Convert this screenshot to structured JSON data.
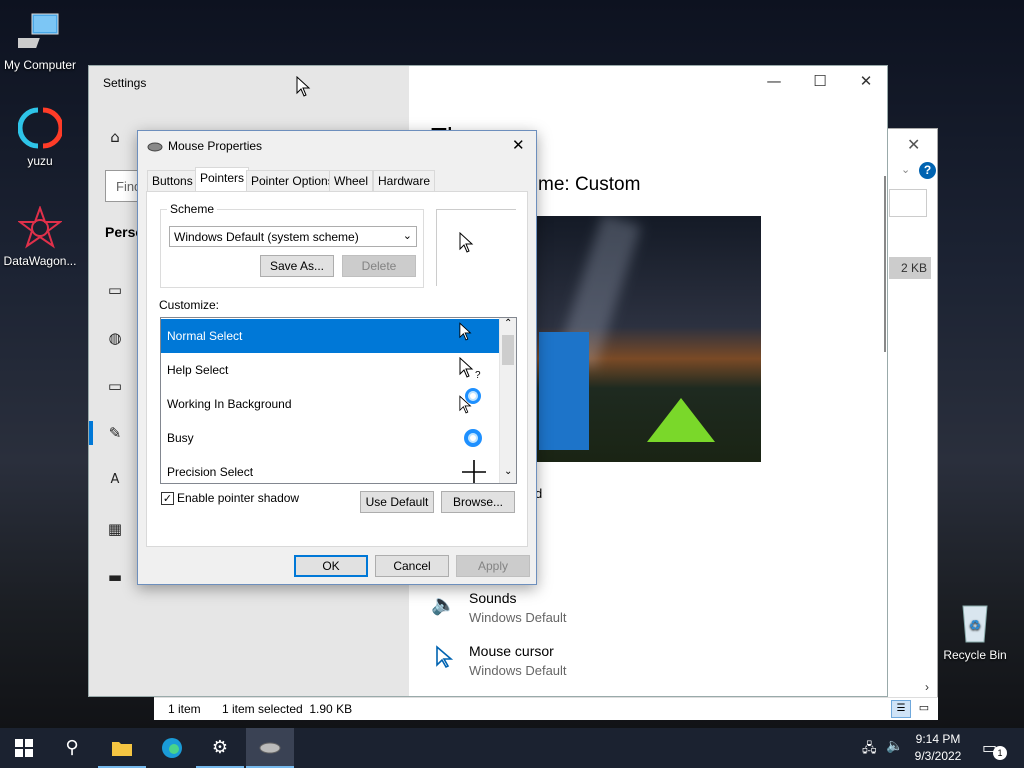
{
  "desktop": {
    "icons": [
      {
        "label": "My Computer"
      },
      {
        "label": "yuzu"
      },
      {
        "label": "DataWagon..."
      },
      {
        "label": "Recycle Bin"
      }
    ]
  },
  "settings": {
    "title": "Settings",
    "search_placeholder": "Find",
    "section_label": "Perso",
    "right": {
      "heading_fragment": "Th",
      "theme_label": "Theme: Custom",
      "theme_label_visible": "me: Custom",
      "fragment_d": "d",
      "sounds": {
        "title": "Sounds",
        "value": "Windows Default"
      },
      "mouse_cursor": {
        "title": "Mouse cursor",
        "value": "Windows Default"
      }
    }
  },
  "explorer": {
    "size_cell": "2 KB",
    "status": {
      "items": "1 item",
      "selected": "1 item selected  1.90 KB"
    }
  },
  "mouse_dialog": {
    "title": "Mouse Properties",
    "tabs": [
      "Buttons",
      "Pointers",
      "Pointer Options",
      "Wheel",
      "Hardware"
    ],
    "active_tab": "Pointers",
    "scheme_group": "Scheme",
    "scheme_value": "Windows Default (system scheme)",
    "save_as": "Save As...",
    "delete": "Delete",
    "customize_label": "Customize:",
    "cursors": [
      {
        "name": "Normal Select",
        "selected": true
      },
      {
        "name": "Help Select",
        "selected": false
      },
      {
        "name": "Working In Background",
        "selected": false
      },
      {
        "name": "Busy",
        "selected": false
      },
      {
        "name": "Precision Select",
        "selected": false
      }
    ],
    "shadow_label": "Enable pointer shadow",
    "shadow_checked": true,
    "use_default": "Use Default",
    "browse": "Browse...",
    "ok": "OK",
    "cancel": "Cancel",
    "apply": "Apply"
  },
  "taskbar": {
    "time": "9:14 PM",
    "date": "9/3/2022",
    "notification_count": "1"
  },
  "colors": {
    "accent": "#0078d7",
    "taskbar": "#1b2230"
  }
}
